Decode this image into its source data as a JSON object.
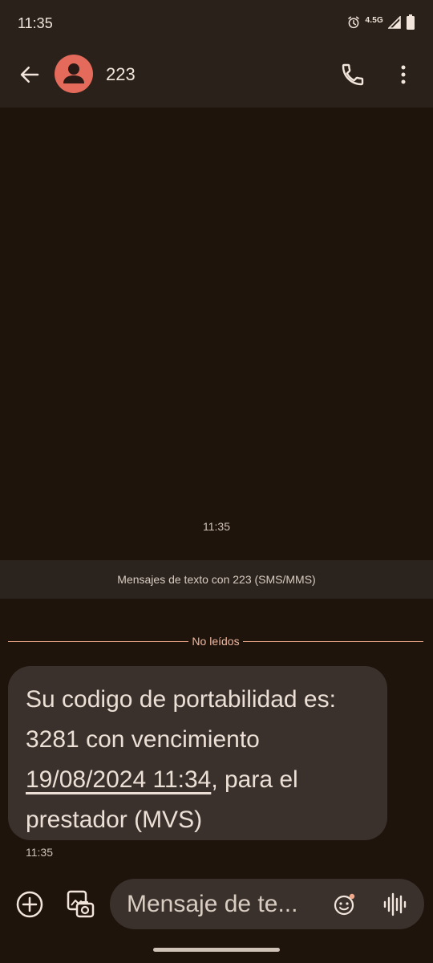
{
  "status_bar": {
    "time": "11:35",
    "network": "4.5G",
    "icons": [
      "alarm-icon",
      "signal-icon",
      "battery-icon"
    ]
  },
  "header": {
    "contact_name": "223",
    "icons": [
      "back-arrow-icon",
      "person-icon",
      "phone-icon",
      "more-vert-icon"
    ]
  },
  "thread": {
    "timestamp": "11:35",
    "sms_banner": "Mensajes de texto con 223 (SMS/MMS)",
    "unread_label": "No leídos",
    "message": {
      "text_part1": "Su codigo de portabilidad es: 3281 con vencimiento ",
      "date_link": "19/08/2024 11:34",
      "text_part2": ", para el prestador (MVS)",
      "time": "11:35"
    }
  },
  "composer": {
    "placeholder": "Mensaje de te...",
    "icons": [
      "add-circle-icon",
      "gallery-icon",
      "emoji-icon",
      "voice-icon"
    ]
  },
  "colors": {
    "background": "#1f140c",
    "bar": "#2a211b",
    "bubble": "#3a312d",
    "avatar": "#e46a5b",
    "accent": "#f0a98a"
  }
}
